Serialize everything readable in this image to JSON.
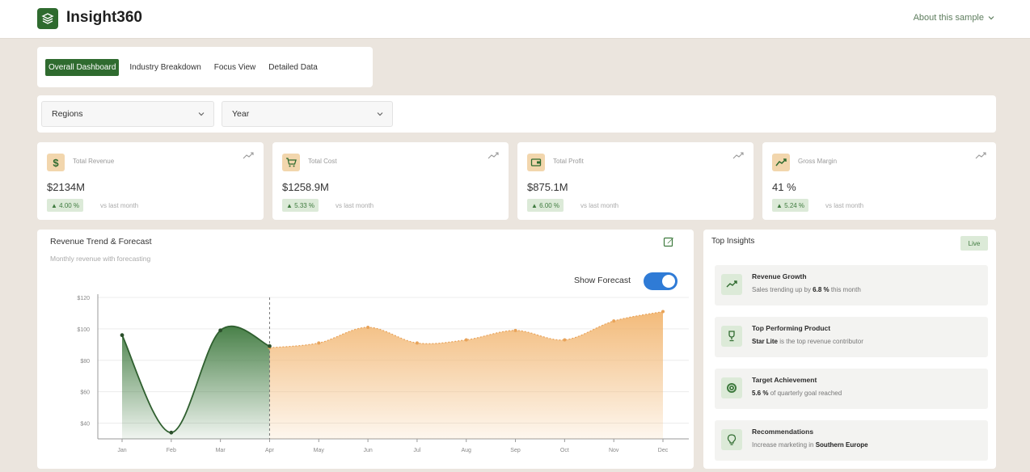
{
  "app": {
    "title": "Insight360",
    "about_label": "About this sample"
  },
  "tabs": [
    {
      "label": "Overall Dashboard",
      "active": true
    },
    {
      "label": "Industry Breakdown",
      "active": false
    },
    {
      "label": "Focus View",
      "active": false
    },
    {
      "label": "Detailed Data",
      "active": false
    }
  ],
  "filters": {
    "regions_label": "Regions",
    "year_label": "Year"
  },
  "kpis": [
    {
      "icon": "dollar-icon",
      "label": "Total Revenue",
      "value": "$2134M",
      "change": "▲ 4.00 %",
      "note": "vs last month"
    },
    {
      "icon": "cart-icon",
      "label": "Total Cost",
      "value": "$1258.9M",
      "change": "▲ 5.33 %",
      "note": "vs last month"
    },
    {
      "icon": "wallet-icon",
      "label": "Total Profit",
      "value": "$875.1M",
      "change": "▲ 6.00 %",
      "note": "vs last month"
    },
    {
      "icon": "trend-icon",
      "label": "Gross Margin",
      "value": "41 %",
      "change": "▲ 5.24 %",
      "note": "vs last month"
    }
  ],
  "chart_panel": {
    "title": "Revenue Trend & Forecast",
    "subtitle": "Monthly revenue with forecasting",
    "toggle_label": "Show Forecast",
    "toggle_on": true
  },
  "chart_data": {
    "type": "area",
    "categories": [
      "Jan",
      "Feb",
      "Mar",
      "Apr",
      "May",
      "Jun",
      "Jul",
      "Aug",
      "Sep",
      "Oct",
      "Nov",
      "Dec"
    ],
    "ylim": [
      30,
      120
    ],
    "yticks": [
      40,
      60,
      80,
      100,
      120
    ],
    "ytick_labels": [
      "$40",
      "$60",
      "$80",
      "$100",
      "$120"
    ],
    "series": [
      {
        "role": "actual",
        "values": [
          96,
          34,
          99,
          89,
          null,
          null,
          null,
          null,
          null,
          null,
          null,
          null
        ],
        "color": "#2f6b2f"
      },
      {
        "role": "forecast",
        "values": [
          null,
          null,
          null,
          88,
          91,
          101,
          91,
          93,
          99,
          93,
          105,
          111
        ],
        "color": "#f2b773"
      }
    ],
    "split_index": 3,
    "grid": true,
    "legend": "none"
  },
  "insights": {
    "title": "Top Insights",
    "badge": "Live",
    "items": [
      {
        "icon": "trend-up-icon",
        "title": "Revenue Growth",
        "pre": "Sales trending up by ",
        "bold": "6.8 %",
        "post": " this month"
      },
      {
        "icon": "trophy-icon",
        "title": "Top Performing Product",
        "pre": "",
        "bold": "Star Lite",
        "post": " is the top revenue contributor"
      },
      {
        "icon": "target-icon",
        "title": "Target Achievement",
        "pre": "",
        "bold": "5.6 %",
        "post": " of quarterly goal reached"
      },
      {
        "icon": "lightbulb-icon",
        "title": "Recommendations",
        "pre": "Increase marketing in ",
        "bold": "Southern Europe",
        "post": ""
      }
    ]
  }
}
